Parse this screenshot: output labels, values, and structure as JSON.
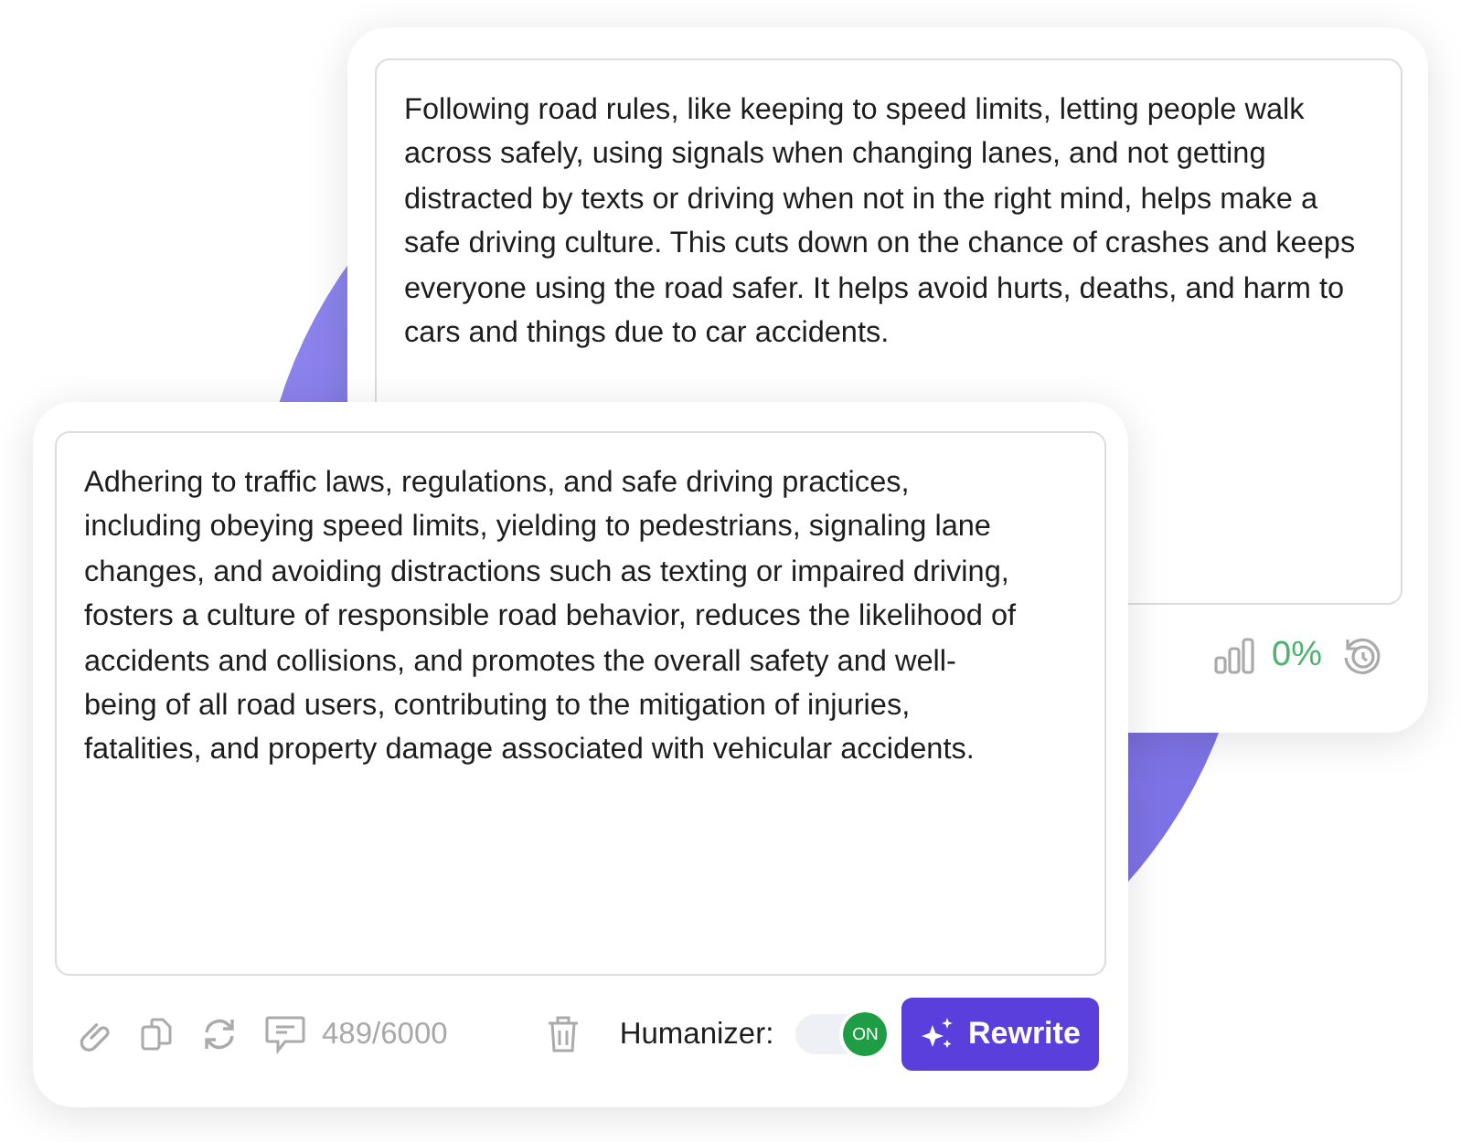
{
  "back_card": {
    "text": "Following road rules, like keeping to speed limits, letting people walk across safely, using signals when changing lanes, and not getting distracted by texts or driving when not in the right mind, helps make a safe driving culture. This cuts down on the chance of crashes and keeps everyone using the road safer. It helps avoid hurts, deaths, and harm to cars and things due to car accidents.",
    "score": "0%"
  },
  "front_card": {
    "text": "Adhering to traffic laws, regulations, and safe driving practices, including obeying speed limits, yielding to pedestrians, signaling lane changes, and avoiding distractions such as texting or impaired driving, fosters a culture of responsible road behavior, reduces the likelihood of accidents and collisions, and promotes the overall safety and well-being of all road users, contributing to the mitigation of injuries, fatalities, and property damage associated with vehicular accidents.",
    "char_count": "489/6000",
    "humanizer": {
      "label": "Humanizer:",
      "on": true,
      "state_label": "ON"
    },
    "rewrite_button": "Rewrite"
  }
}
